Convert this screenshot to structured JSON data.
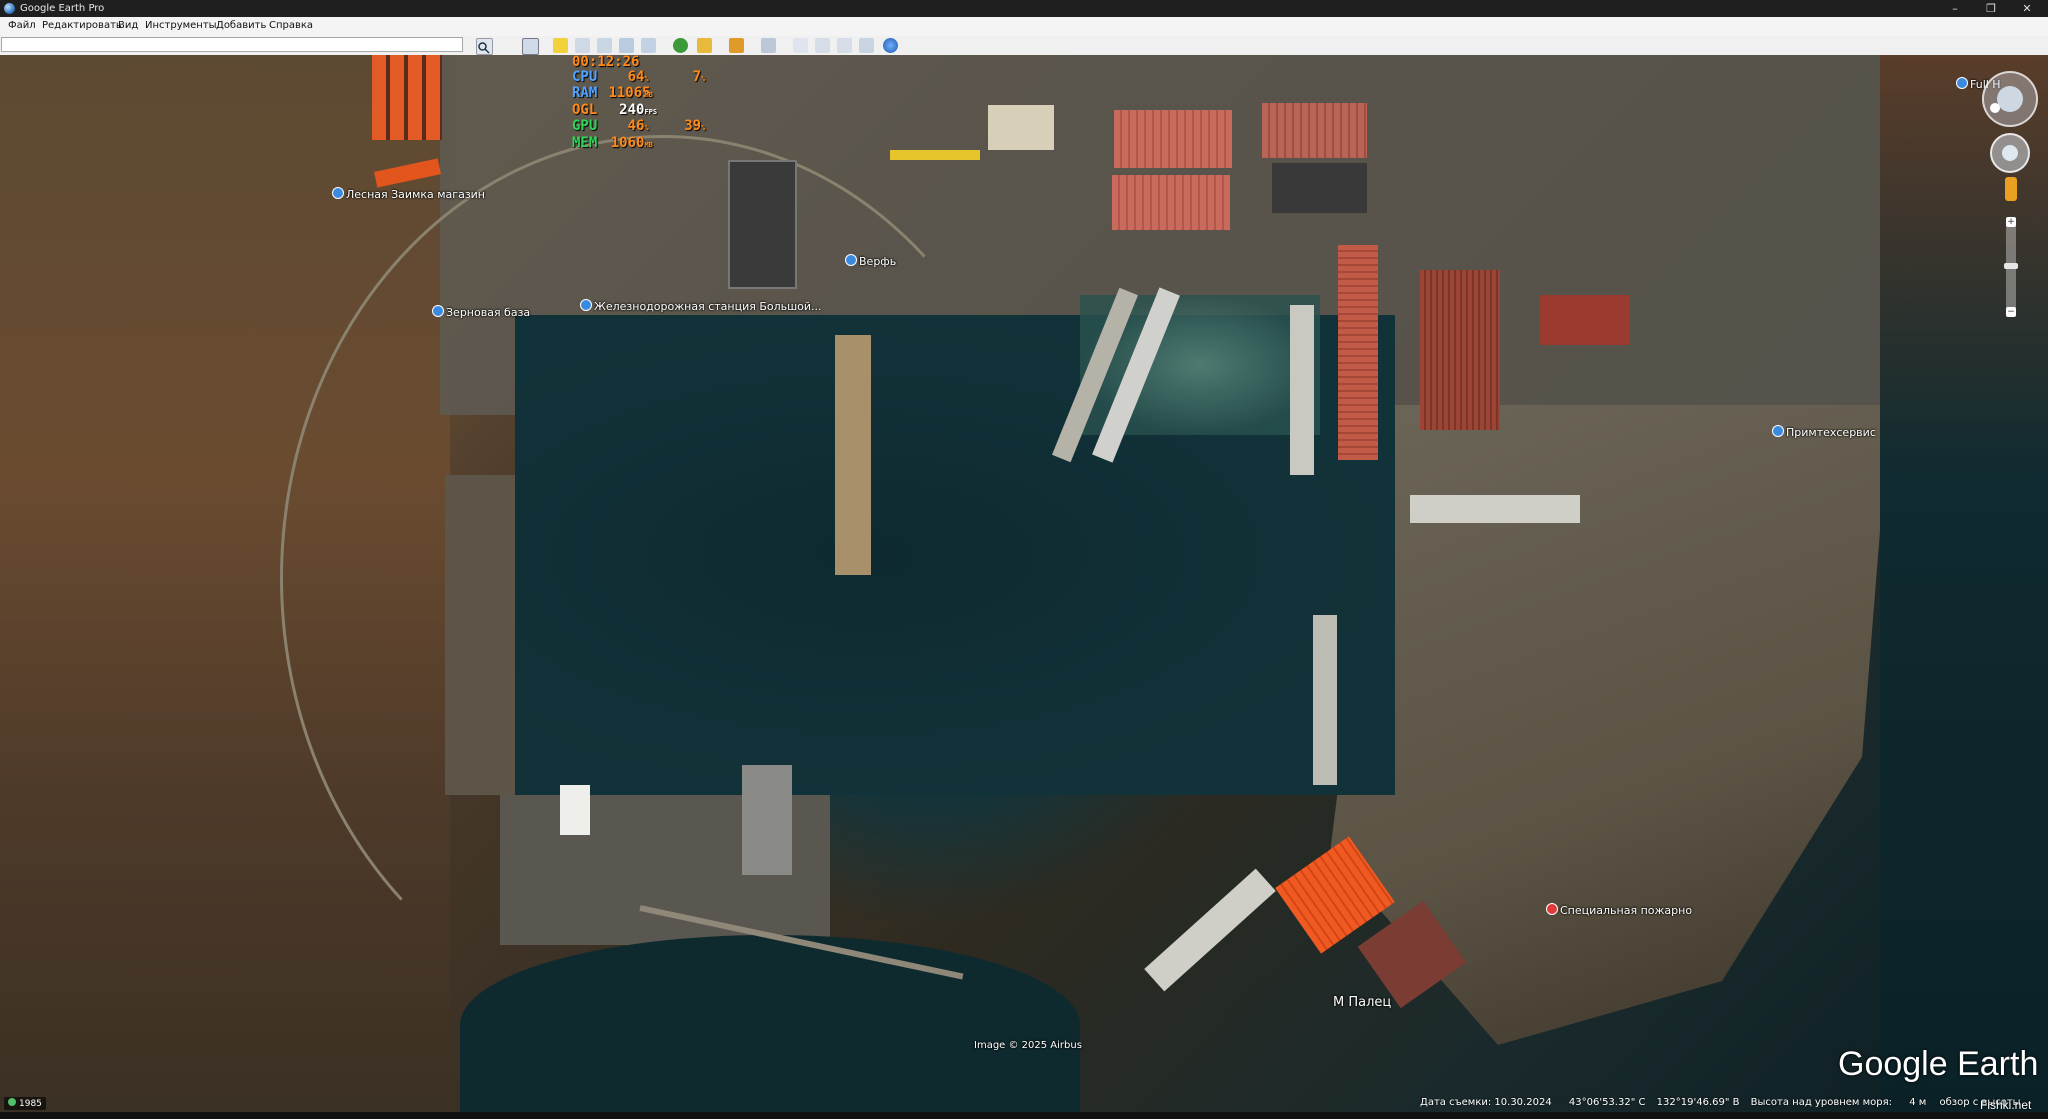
{
  "window": {
    "title": "Google Earth Pro",
    "minimize": "–",
    "maximize": "❐",
    "close": "✕"
  },
  "menu": [
    "Файл",
    "Редактировать",
    "Вид",
    "Инструменты",
    "Добавить",
    "Справка"
  ],
  "search": {
    "value": "",
    "placeholder": ""
  },
  "toolbar_icons": [
    "search-icon",
    "sidebar-toggle-icon",
    "placemark-icon",
    "polygon-icon",
    "path-icon",
    "image-overlay-icon",
    "record-tour-icon",
    "historical-imagery-icon",
    "sunlight-icon",
    "planets-icon",
    "ruler-icon",
    "email-icon",
    "print-icon",
    "save-image-icon",
    "view-in-maps-icon",
    "earth-icon"
  ],
  "overlay_stats": {
    "time": "00:12:26",
    "rows": [
      {
        "label": "CPU",
        "value": "64",
        "unit": "%",
        "value2": "7",
        "unit2": "%"
      },
      {
        "label": "RAM",
        "value": "11065",
        "unit": "MB"
      },
      {
        "label": "OGL",
        "value": "240",
        "unit": "FPS"
      },
      {
        "label": "GPU",
        "value": "46",
        "unit": "%",
        "value2": "39",
        "unit2": "%"
      },
      {
        "label": "MEM",
        "value": "1060",
        "unit": "MB"
      }
    ],
    "colors": {
      "time": "#ff8a1a",
      "cpu": "#4fa3ff",
      "ram": "#ff8a1a",
      "ogl": "#ffffff",
      "gpu": "#2fd35a",
      "mem": "#2fd35a"
    }
  },
  "places": [
    {
      "name": "Лесная Заимка магазин"
    },
    {
      "name": "Зерновая база"
    },
    {
      "name": "Железнодорожная станция Большой..."
    },
    {
      "name": "Верфь"
    },
    {
      "name": "Примтехсервис"
    },
    {
      "name": "Специальная пожарно"
    },
    {
      "name": "Full H"
    }
  ],
  "map_labels": {
    "cape": "М  Палец",
    "credit": "Image © 2025 Airbus"
  },
  "brand": "Google Earth",
  "status": {
    "date": "Дата съемки: 10.30.2024",
    "lat": "43°06'53.32\" С",
    "lon": "132°19'46.69\" В",
    "elev_label": "Высота над уровнем моря:",
    "elev": "4 м",
    "eye": "обзор с высоты",
    "year": "1985"
  },
  "watermark": "Fishki.net"
}
